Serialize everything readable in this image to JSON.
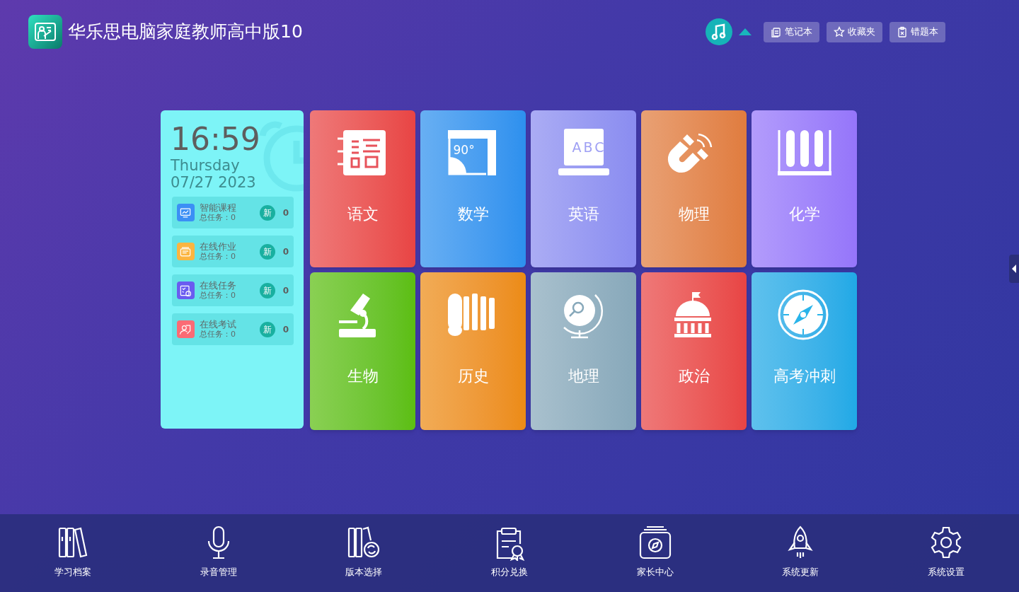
{
  "app": {
    "title": "华乐思电脑家庭教师高中版10"
  },
  "toolbar": {
    "music_panel_expanded": true,
    "buttons": [
      {
        "kind": "notebook",
        "label": "笔记本"
      },
      {
        "kind": "favorites",
        "label": "收藏夹"
      },
      {
        "kind": "mistakes",
        "label": "错题本"
      }
    ]
  },
  "clock": {
    "time": "16:59",
    "weekday": "Thursday",
    "date": "07/27 2023"
  },
  "tasks": [
    {
      "kind": "course",
      "title": "智能课程",
      "total": "总任务：0",
      "badge": "新",
      "count": "0",
      "color": "#3b8ff5"
    },
    {
      "kind": "homework",
      "title": "在线作业",
      "total": "总任务：0",
      "badge": "新",
      "count": "0",
      "color": "#fbb540"
    },
    {
      "kind": "task",
      "title": "在线任务",
      "total": "总任务：0",
      "badge": "新",
      "count": "0",
      "color": "#6a5cf0"
    },
    {
      "kind": "exam",
      "title": "在线考试",
      "total": "总任务：0",
      "badge": "新",
      "count": "0",
      "color": "#fb6b75"
    }
  ],
  "subjects": [
    {
      "kind": "chinese",
      "label": "语文",
      "color": "#e84444"
    },
    {
      "kind": "math",
      "label": "数学",
      "color": "#2d90ee",
      "icon_text": "90°"
    },
    {
      "kind": "english",
      "label": "英语",
      "color": "#8a8cf0",
      "icon_text": "ABC"
    },
    {
      "kind": "physics",
      "label": "物理",
      "color": "#e07c3e"
    },
    {
      "kind": "chemistry",
      "label": "化学",
      "color": "#9575fa"
    },
    {
      "kind": "biology",
      "label": "生物",
      "color": "#5cbe10"
    },
    {
      "kind": "history",
      "label": "历史",
      "color": "#ec8b14"
    },
    {
      "kind": "geography",
      "label": "地理",
      "color": "#87a8ba"
    },
    {
      "kind": "politics",
      "label": "政治",
      "color": "#e84444"
    },
    {
      "kind": "exam",
      "label": "高考冲刺",
      "color": "#20a9e6"
    }
  ],
  "bottom_nav": [
    {
      "kind": "books",
      "label": "学习档案"
    },
    {
      "kind": "mic",
      "label": "录音管理"
    },
    {
      "kind": "version",
      "label": "版本选择"
    },
    {
      "kind": "points",
      "label": "积分兑换"
    },
    {
      "kind": "parent",
      "label": "家长中心"
    },
    {
      "kind": "rocket",
      "label": "系统更新"
    },
    {
      "kind": "gear",
      "label": "系统设置"
    }
  ]
}
